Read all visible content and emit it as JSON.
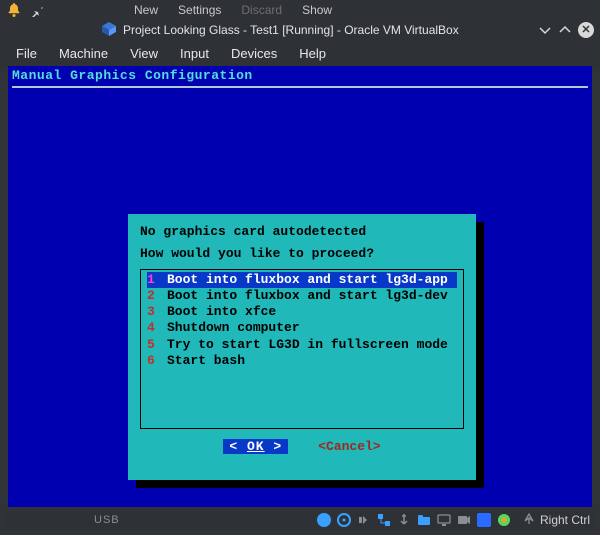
{
  "taskbar": {
    "mini_menu": {
      "new": "New",
      "settings": "Settings",
      "discard": "Discard",
      "show": "Show"
    }
  },
  "window": {
    "title": "Project Looking Glass - Test1 [Running] - Oracle VM VirtualBox"
  },
  "menubar": {
    "file": "File",
    "machine": "Machine",
    "view": "View",
    "input": "Input",
    "devices": "Devices",
    "help": "Help"
  },
  "console": {
    "title": "Manual Graphics Configuration",
    "dialog": {
      "message_line1": "No graphics card autodetected",
      "message_line2": "How would you like to proceed?",
      "options": [
        {
          "num": "1",
          "label": "Boot into fluxbox and start lg3d-app"
        },
        {
          "num": "2",
          "label": "Boot into fluxbox and start lg3d-dev"
        },
        {
          "num": "3",
          "label": "Boot into xfce"
        },
        {
          "num": "4",
          "label": "Shutdown computer"
        },
        {
          "num": "5",
          "label": "Try to start LG3D in fullscreen mode"
        },
        {
          "num": "6",
          "label": "Start bash"
        }
      ],
      "selected_index": 0,
      "ok_label": "OK",
      "ok_decorated_left": "<  ",
      "ok_decorated_right": "  >",
      "cancel_label": "<Cancel>"
    }
  },
  "statusbar": {
    "usb_text": "USB",
    "host_key": "Right Ctrl",
    "icons": [
      "hard-disk-icon",
      "optical-disc-icon",
      "audio-icon",
      "network-icon",
      "usb-icon",
      "shared-folder-icon",
      "display-icon",
      "recording-icon",
      "virtualization-icon",
      "guest-additions-icon"
    ],
    "colors": {
      "disc": "#39a0ff",
      "net": "#39a0ff",
      "vbox": "#2a6bff",
      "green": "#58d858",
      "orange": "#f0a030",
      "grey": "#8a8f94"
    }
  }
}
